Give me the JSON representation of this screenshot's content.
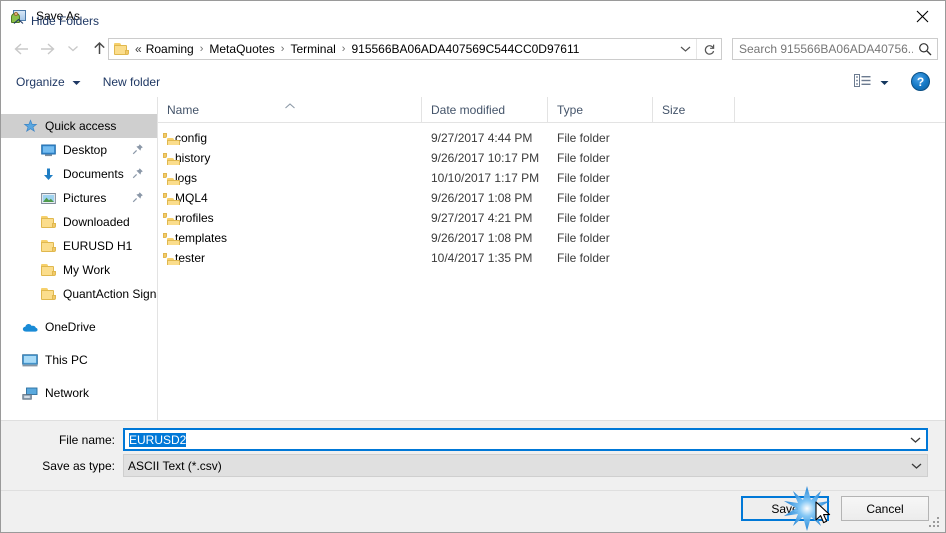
{
  "window": {
    "title": "Save As",
    "icon": "save-as-app-icon",
    "close_icon": "close-icon"
  },
  "navigation": {
    "back_icon": "back-arrow-icon",
    "forward_icon": "forward-arrow-icon",
    "recent_icon": "recent-locations-chevron-icon",
    "up_icon": "up-arrow-icon",
    "address": {
      "folder_icon": "folder-icon",
      "overflow": "«",
      "separator": "›",
      "crumbs": [
        "Roaming",
        "MetaQuotes",
        "Terminal",
        "915566BA06ADA407569C544CC0D97611"
      ],
      "dropdown_icon": "chevron-down-icon",
      "refresh_icon": "refresh-icon"
    },
    "search": {
      "placeholder": "Search 915566BA06ADA40756...",
      "icon": "search-icon"
    }
  },
  "toolbar": {
    "organize_label": "Organize",
    "organize_dropdown_icon": "chevron-down-icon",
    "new_folder_label": "New folder",
    "view_icon": "view-layout-icon",
    "view_dropdown_icon": "chevron-down-icon",
    "help_label": "?",
    "help_icon": "help-icon"
  },
  "sidebar": {
    "items": [
      {
        "label": "Quick access",
        "icon": "quick-access-star-icon",
        "level": 0,
        "selected": true,
        "pinned": false
      },
      {
        "label": "Desktop",
        "icon": "desktop-monitor-icon",
        "level": 1,
        "selected": false,
        "pinned": true
      },
      {
        "label": "Documents",
        "icon": "documents-down-arrow-icon",
        "level": 1,
        "selected": false,
        "pinned": true
      },
      {
        "label": "Pictures",
        "icon": "pictures-image-icon",
        "level": 1,
        "selected": false,
        "pinned": true
      },
      {
        "label": "Downloaded",
        "icon": "folder-icon",
        "level": 1,
        "selected": false,
        "pinned": false
      },
      {
        "label": "EURUSD H1",
        "icon": "folder-icon",
        "level": 1,
        "selected": false,
        "pinned": false
      },
      {
        "label": "My Work",
        "icon": "folder-icon",
        "level": 1,
        "selected": false,
        "pinned": false
      },
      {
        "label": "QuantAction Signal",
        "icon": "folder-icon",
        "level": 1,
        "selected": false,
        "pinned": false
      },
      {
        "label": "OneDrive",
        "icon": "onedrive-cloud-icon",
        "level": 0,
        "selected": false,
        "pinned": false,
        "gap_before": true
      },
      {
        "label": "This PC",
        "icon": "this-pc-monitor-icon",
        "level": 0,
        "selected": false,
        "pinned": false,
        "gap_before": true
      },
      {
        "label": "Network",
        "icon": "network-icon",
        "level": 0,
        "selected": false,
        "pinned": false,
        "gap_before": true
      }
    ]
  },
  "filelist": {
    "columns": [
      {
        "label": "Name",
        "sorted": "asc"
      },
      {
        "label": "Date modified",
        "sorted": ""
      },
      {
        "label": "Type",
        "sorted": ""
      },
      {
        "label": "Size",
        "sorted": ""
      }
    ],
    "rows": [
      {
        "name": "config",
        "date": "9/27/2017 4:44 PM",
        "type": "File folder",
        "size": "",
        "icon": "folder-icon"
      },
      {
        "name": "history",
        "date": "9/26/2017 10:17 PM",
        "type": "File folder",
        "size": "",
        "icon": "folder-icon"
      },
      {
        "name": "logs",
        "date": "10/10/2017 1:17 PM",
        "type": "File folder",
        "size": "",
        "icon": "folder-icon"
      },
      {
        "name": "MQL4",
        "date": "9/26/2017 1:08 PM",
        "type": "File folder",
        "size": "",
        "icon": "folder-icon"
      },
      {
        "name": "profiles",
        "date": "9/27/2017 4:21 PM",
        "type": "File folder",
        "size": "",
        "icon": "folder-icon"
      },
      {
        "name": "templates",
        "date": "9/26/2017 1:08 PM",
        "type": "File folder",
        "size": "",
        "icon": "folder-icon"
      },
      {
        "name": "tester",
        "date": "10/4/2017 1:35 PM",
        "type": "File folder",
        "size": "",
        "icon": "folder-icon"
      }
    ]
  },
  "form": {
    "filename_label": "File name:",
    "filename_value": "EURUSD2",
    "filename_selected": true,
    "filetype_label": "Save as type:",
    "filetype_value": "ASCII Text (*.csv)",
    "dropdown_icon": "chevron-down-icon"
  },
  "footer": {
    "hide_folders_label": "Hide Folders",
    "hide_folders_icon": "chevron-up-icon",
    "save_label": "Save",
    "cancel_label": "Cancel",
    "resize_grip_icon": "resize-grip-icon",
    "click_effect_icon": "click-burst-icon",
    "cursor_icon": "mouse-pointer-icon"
  },
  "colors": {
    "accent": "#0078d7",
    "selection": "#0078d7",
    "sidebar_selected": "#cfcfcf",
    "link_text": "#1f3864",
    "folder_yellow": "#fbdd8c",
    "panel_bg": "#f0f0f0"
  }
}
